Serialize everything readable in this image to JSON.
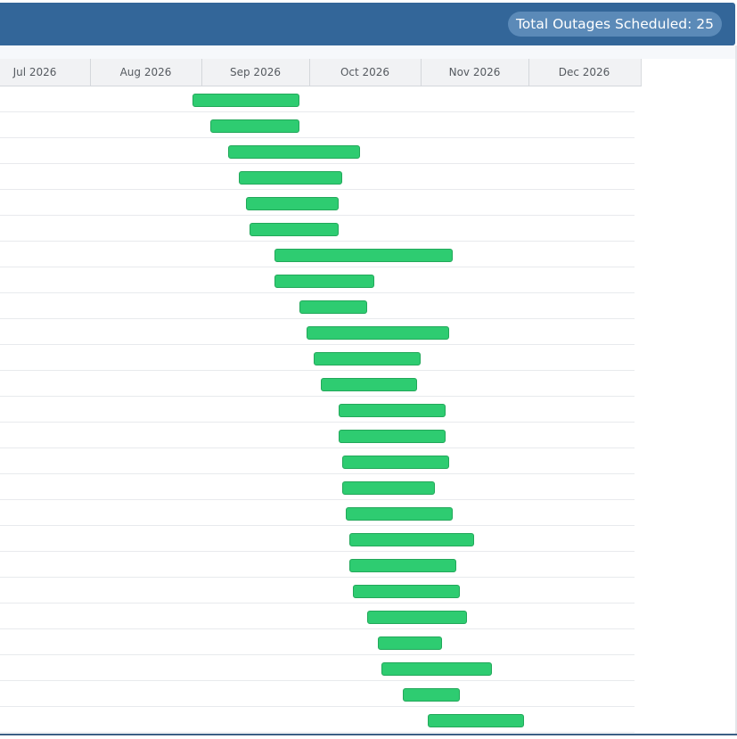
{
  "header": {
    "total_label": "Total Outages Scheduled: 25",
    "color": "#336699"
  },
  "timeline": {
    "months": [
      "Jul 2026",
      "Aug 2026",
      "Sep 2026",
      "Oct 2026",
      "Nov 2026",
      "Dec 2026"
    ]
  },
  "outages": [
    {
      "start": "2026-08-28",
      "end": "2026-09-27"
    },
    {
      "start": "2026-09-02",
      "end": "2026-09-27"
    },
    {
      "start": "2026-09-07",
      "end": "2026-10-14"
    },
    {
      "start": "2026-09-10",
      "end": "2026-10-09"
    },
    {
      "start": "2026-09-12",
      "end": "2026-10-08"
    },
    {
      "start": "2026-09-13",
      "end": "2026-10-08"
    },
    {
      "start": "2026-09-20",
      "end": "2026-11-09"
    },
    {
      "start": "2026-09-20",
      "end": "2026-10-18"
    },
    {
      "start": "2026-09-27",
      "end": "2026-10-16"
    },
    {
      "start": "2026-09-29",
      "end": "2026-11-08"
    },
    {
      "start": "2026-10-01",
      "end": "2026-10-31"
    },
    {
      "start": "2026-10-03",
      "end": "2026-10-30"
    },
    {
      "start": "2026-10-08",
      "end": "2026-11-07"
    },
    {
      "start": "2026-10-08",
      "end": "2026-11-07"
    },
    {
      "start": "2026-10-09",
      "end": "2026-11-08"
    },
    {
      "start": "2026-10-09",
      "end": "2026-11-04"
    },
    {
      "start": "2026-10-10",
      "end": "2026-11-09"
    },
    {
      "start": "2026-10-11",
      "end": "2026-11-15"
    },
    {
      "start": "2026-10-11",
      "end": "2026-11-10"
    },
    {
      "start": "2026-10-12",
      "end": "2026-11-11"
    },
    {
      "start": "2026-10-16",
      "end": "2026-11-13"
    },
    {
      "start": "2026-10-19",
      "end": "2026-11-06"
    },
    {
      "start": "2026-10-20",
      "end": "2026-11-20"
    },
    {
      "start": "2026-10-26",
      "end": "2026-11-11"
    },
    {
      "start": "2026-11-02",
      "end": "2026-11-29"
    }
  ],
  "bar_color": "#2ecc71"
}
